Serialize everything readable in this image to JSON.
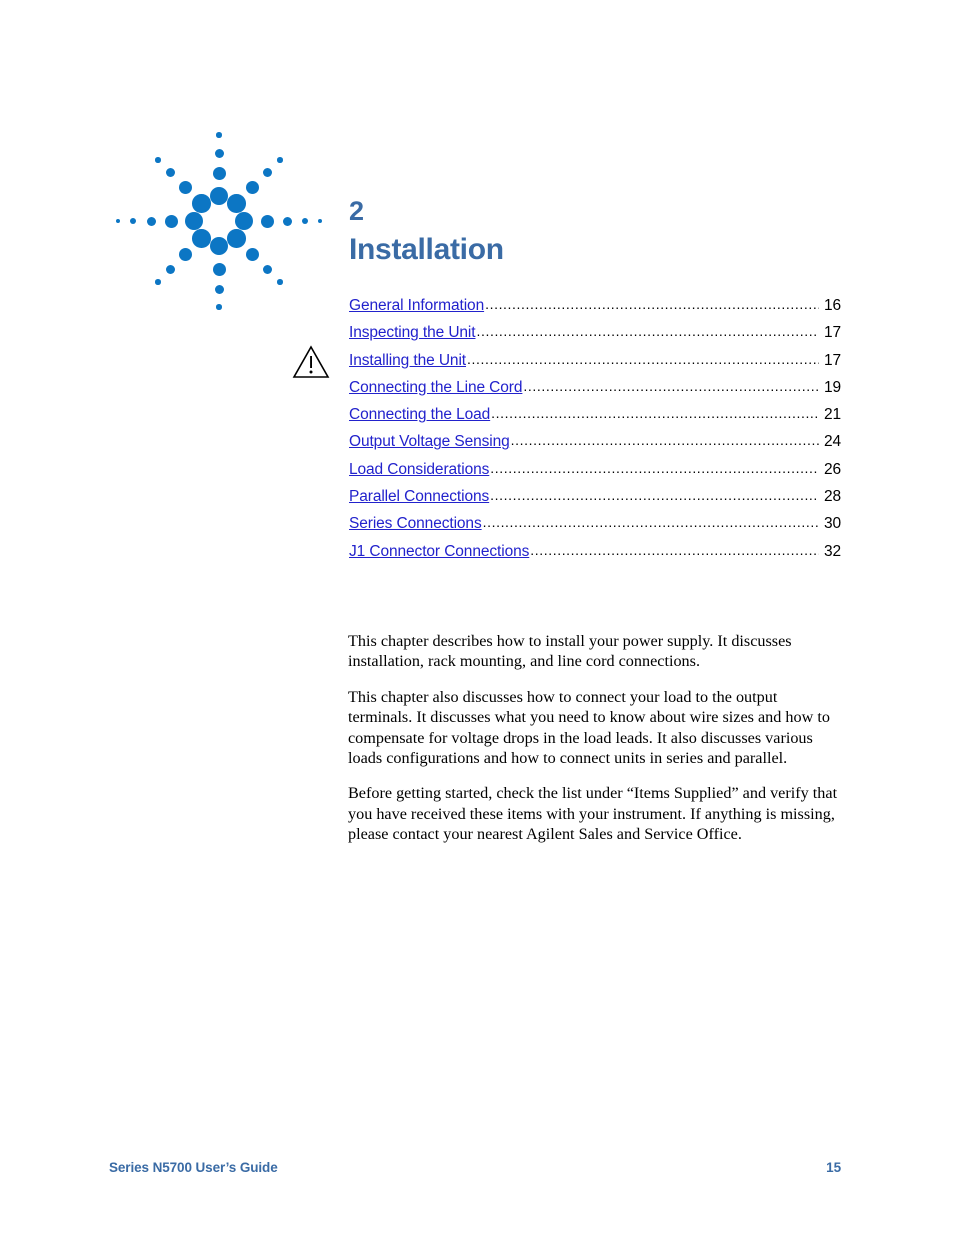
{
  "page": {
    "background_color": "#ffffff",
    "heading_color": "#3a6ba5",
    "link_color": "#2222cc",
    "logo_color": "#0c76c4"
  },
  "logo": {
    "name": "Agilent starburst logo"
  },
  "chapter": {
    "number": "2",
    "title": "Installation"
  },
  "toc": {
    "entries": [
      {
        "label": "General Information",
        "page": "16"
      },
      {
        "label": "Inspecting the Unit",
        "page": "17"
      },
      {
        "label": "Installing the Unit",
        "page": "17"
      },
      {
        "label": "Connecting the Line Cord",
        "page": "19"
      },
      {
        "label": "Connecting the Load",
        "page": "21"
      },
      {
        "label": "Output Voltage Sensing",
        "page": "24"
      },
      {
        "label": "Load Considerations",
        "page": "26"
      },
      {
        "label": "Parallel Connections",
        "page": "28"
      },
      {
        "label": "Series Connections",
        "page": "30"
      },
      {
        "label": "J1 Connector Connections",
        "page": "32"
      }
    ]
  },
  "warning": {
    "icon": "warning-triangle-icon"
  },
  "body": {
    "paragraphs": [
      "This chapter describes how to install your power supply. It discusses installation, rack mounting, and line cord connections.",
      "This chapter also discusses how to connect your load to the output terminals. It discusses what you need to know about wire sizes and how to compensate for voltage drops in the load leads. It also discusses various loads configurations and how to connect units in series and parallel.",
      "Before getting started, check the list under “Items Supplied” and verify that you have received these items with your instrument. If anything is missing, please contact your nearest Agilent Sales and Service Office."
    ]
  },
  "footer": {
    "document_title": "Series N5700 User’s Guide",
    "page_number": "15"
  }
}
